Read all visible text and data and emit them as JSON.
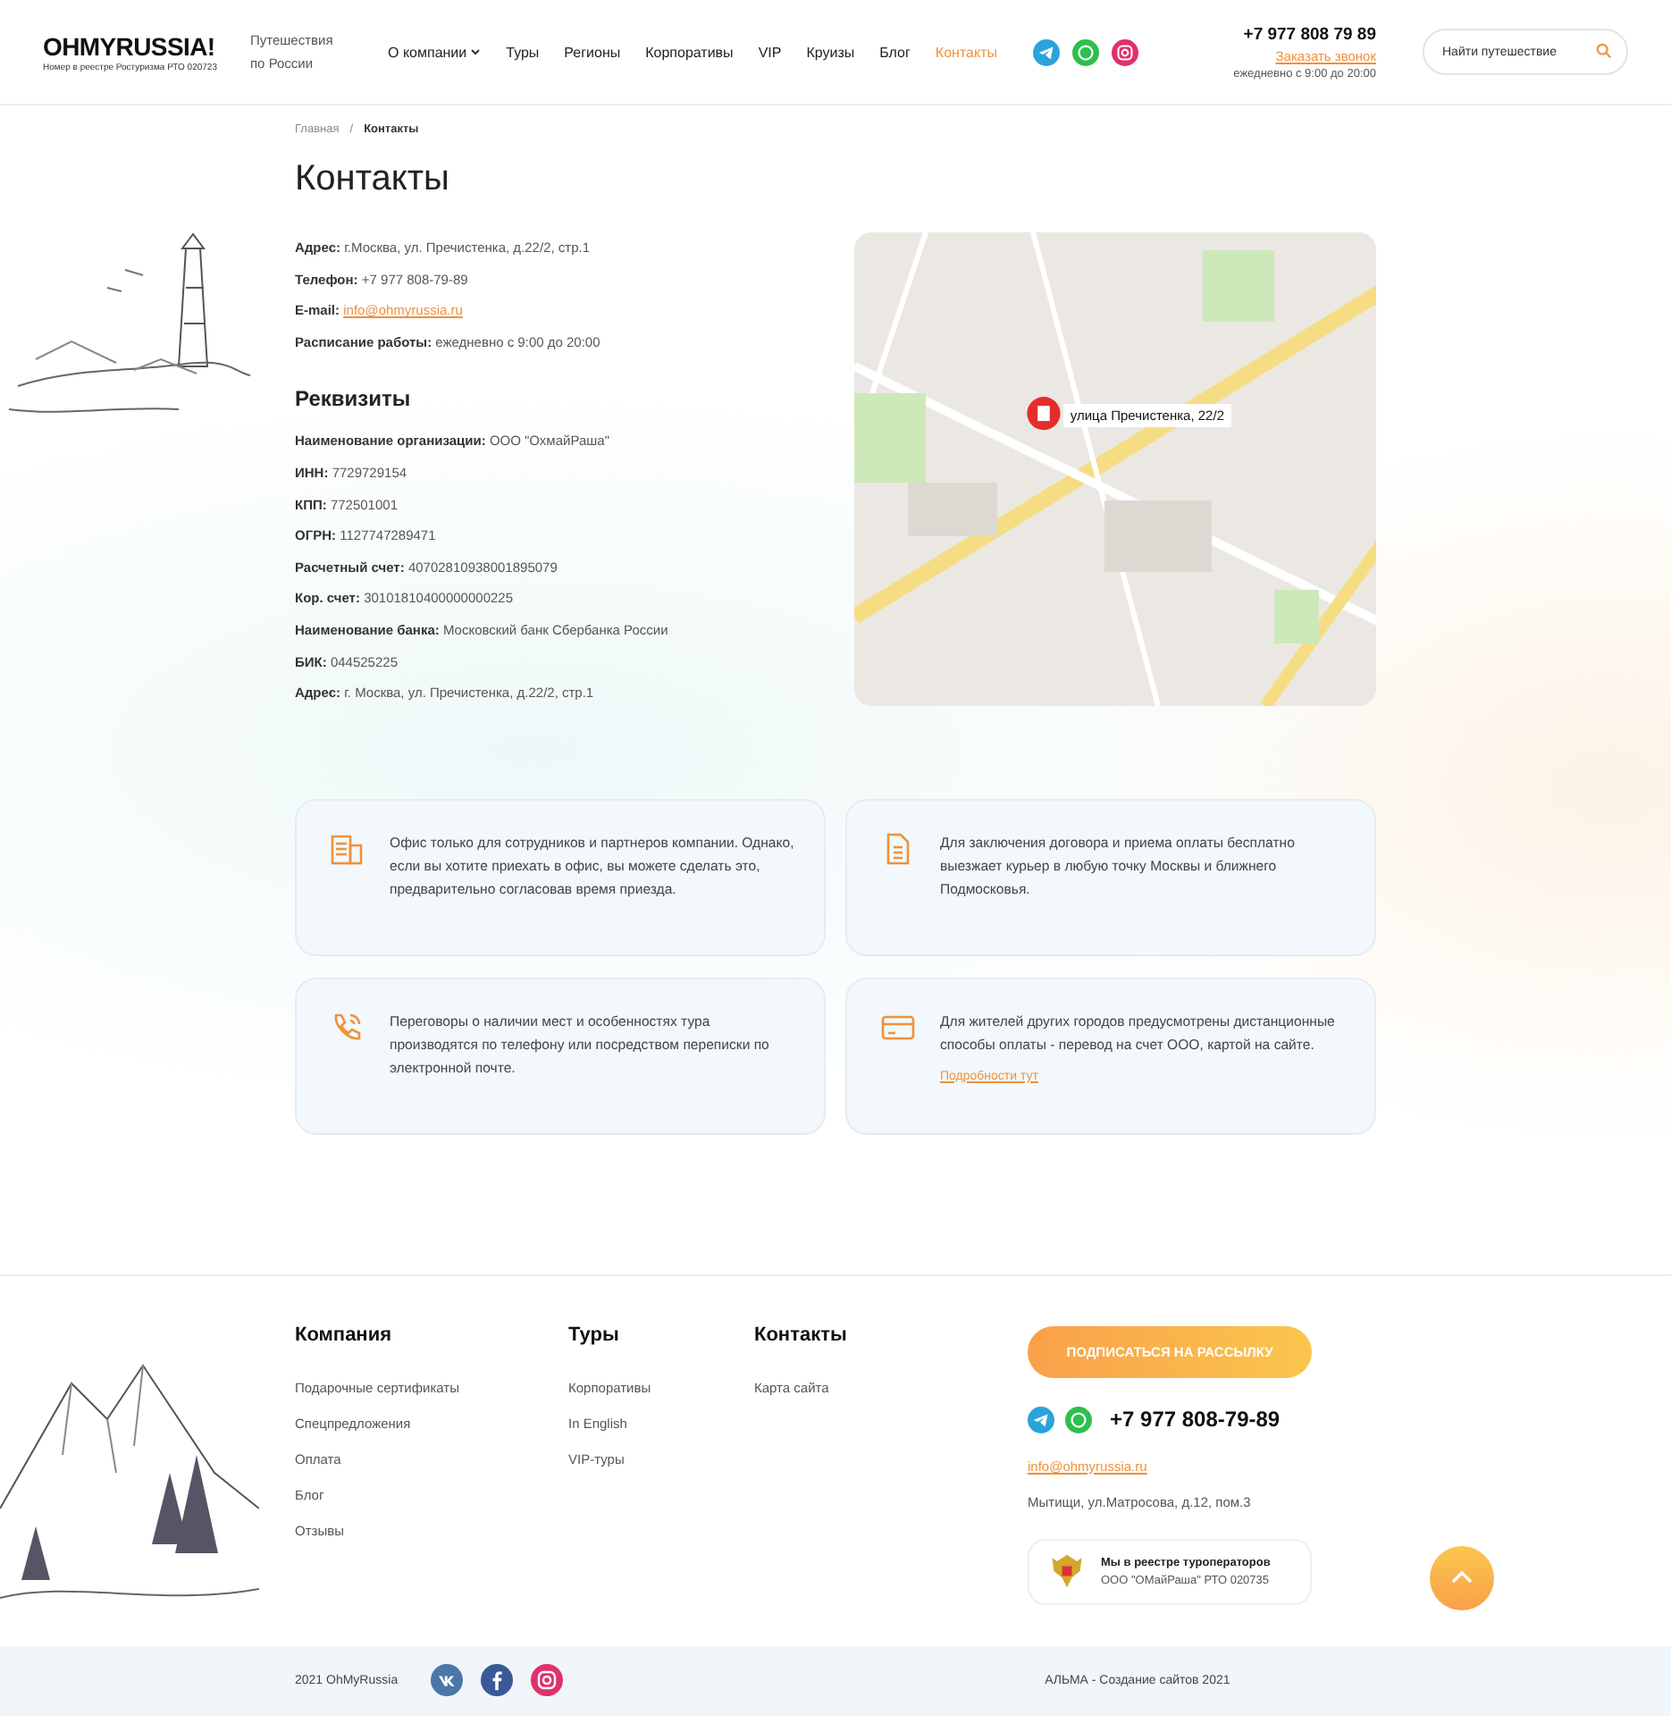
{
  "header": {
    "logo": "OHMYRUSSIA!",
    "logo_caption": "Номер в реестре Ростуризма РТО 020723",
    "tagline": "Путешествия по России",
    "nav": [
      {
        "label": "О компании",
        "dropdown": true,
        "selected": false
      },
      {
        "label": "Туры",
        "dropdown": false,
        "selected": false
      },
      {
        "label": "Регионы",
        "dropdown": false,
        "selected": false
      },
      {
        "label": "Корпоративы",
        "dropdown": false,
        "selected": false
      },
      {
        "label": "VIP",
        "dropdown": false,
        "selected": false
      },
      {
        "label": "Круизы",
        "dropdown": false,
        "selected": false
      },
      {
        "label": "Блог",
        "dropdown": false,
        "selected": false
      },
      {
        "label": "Контакты",
        "dropdown": false,
        "selected": true
      }
    ],
    "social": [
      {
        "kind": "telegram"
      },
      {
        "kind": "whatsapp"
      },
      {
        "kind": "instagram"
      }
    ],
    "phone": "+7 977 808 79 89",
    "callback": "Заказать звонок",
    "hours": "ежедневно с 9:00 до 20:00",
    "search": {
      "placeholder": "Найти путешествие"
    }
  },
  "breadcrumb_separator": "/",
  "breadcrumbs": [
    {
      "label": "Главная",
      "current": false
    },
    {
      "label": "Контакты",
      "current": true
    }
  ],
  "title": "Контакты",
  "contacts": [
    {
      "label": "Адрес:",
      "value": "г.Москва, ул. Пречистенка, д.22/2, стр.1",
      "kind": "text"
    },
    {
      "label": "Телефон:",
      "value": "+7 977 808-79-89",
      "kind": "text"
    },
    {
      "label": "E-mail:",
      "value": "info@ohmyrussia.ru",
      "kind": "link"
    },
    {
      "label": "Расписание работы:",
      "value": "ежедневно с 9:00 до 20:00",
      "kind": "text"
    }
  ],
  "requisites_title": "Реквизиты",
  "requisites": [
    {
      "label": "Наименование организации:",
      "value": "ООО \"ОхмайРаша\""
    },
    {
      "label": "ИНН:",
      "value": "7729729154"
    },
    {
      "label": "КПП:",
      "value": "772501001"
    },
    {
      "label": "ОГРН:",
      "value": "1127747289471"
    },
    {
      "label": "Расчетный счет:",
      "value": "40702810938001895079"
    },
    {
      "label": "Кор. счет:",
      "value": "30101810400000000225"
    },
    {
      "label": "Наименование банка:",
      "value": "Московский банк Сбербанка России"
    },
    {
      "label": "БИК:",
      "value": "044525225"
    },
    {
      "label": "Адрес:",
      "value": "г. Москва, ул. Пречистенка, д.22/2, стр.1"
    }
  ],
  "map": {
    "marker_label": "улица Пречистенка, 22/2"
  },
  "info_cards": [
    {
      "kind": "building",
      "text": "Офис только для сотрудников и партнеров компании. Однако, если вы хотите приехать в офис, вы можете сделать это, предварительно согласовав время приезда."
    },
    {
      "kind": "document",
      "text": "Для заключения договора и приема оплаты бесплатно выезжает курьер в любую точку Москвы и ближнего Подмосковья."
    },
    {
      "kind": "phone",
      "text": "Переговоры о наличии мест и особенностях тура производятся по телефону или посредством переписки по электронной почте."
    },
    {
      "kind": "card",
      "text": "Для жителей других городов предусмотрены дистанционные способы оплаты - перевод на счет ООО, картой на сайте.",
      "link": "Подробности тут"
    }
  ],
  "footer": {
    "columns": [
      {
        "title": "Компания",
        "links": [
          "Подарочные сертификаты",
          "Спецпредложения",
          "Оплата",
          "Блог",
          "Отзывы"
        ]
      },
      {
        "title": "Туры",
        "links": [
          "Корпоративы",
          "In English",
          "VIP-туры"
        ]
      },
      {
        "title": "Контакты",
        "links": [
          "Карта сайта"
        ]
      }
    ],
    "subscribe": "ПОДПИСАТЬСЯ НА РАССЫЛКУ",
    "messengers": [
      {
        "kind": "telegram"
      },
      {
        "kind": "whatsapp"
      }
    ],
    "phone": "+7 977 808-79-89",
    "email": "info@ohmyrussia.ru",
    "address": "Мытищи, ул.Матросова, д.12, пом.3",
    "registry": {
      "title": "Мы в реестре туроператоров",
      "subtitle": "ООО \"ОМайРаша\" РТО 020735"
    }
  },
  "bottom": {
    "copyright": "2021 OhMyRussia",
    "social": [
      {
        "kind": "vk"
      },
      {
        "kind": "facebook"
      },
      {
        "kind": "instagram"
      }
    ],
    "credit": "АЛЬМА - Создание сайтов 2021"
  }
}
